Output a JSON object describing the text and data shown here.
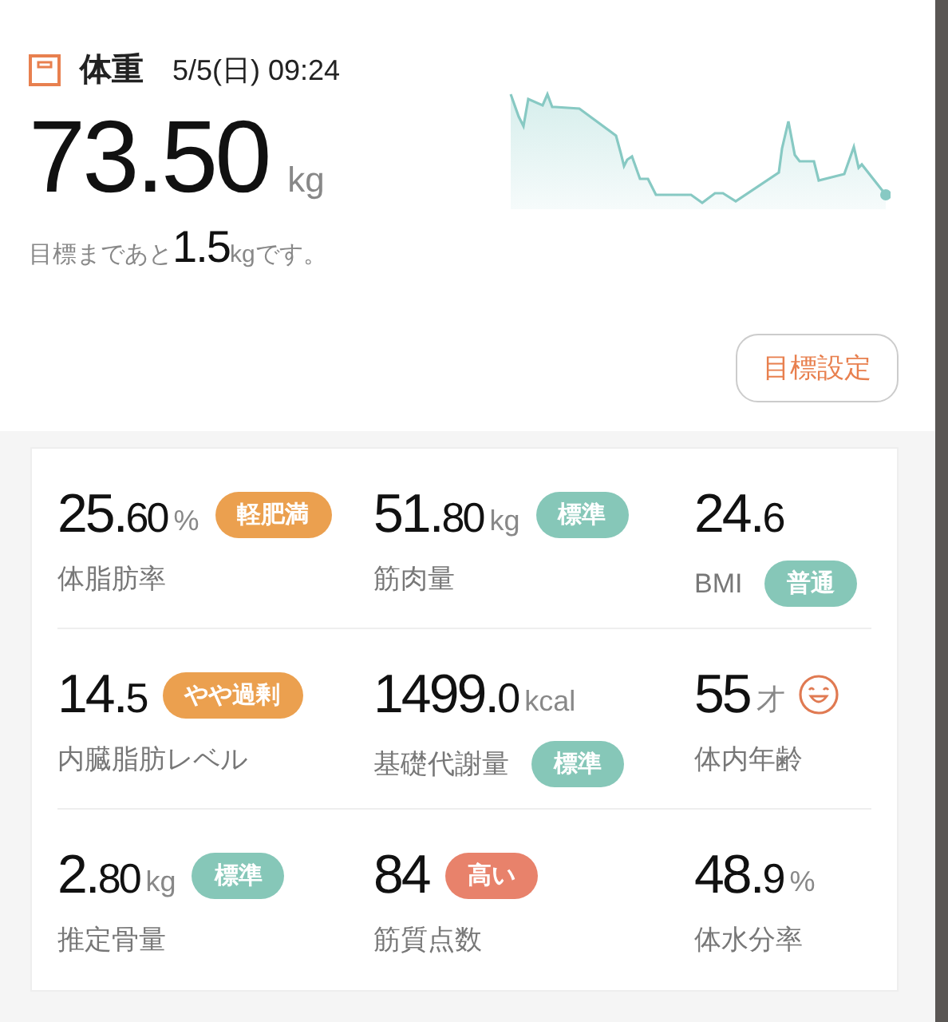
{
  "header": {
    "title": "体重",
    "datetime": "5/5(日) 09:24"
  },
  "weight": {
    "value": "73.50",
    "unit": "kg"
  },
  "goal": {
    "prefix": "目標まであと",
    "amount": "1.5",
    "unit": "kg",
    "suffix": "です。"
  },
  "goal_button": "目標設定",
  "metrics": [
    {
      "kind": "standard",
      "value_main": "25.",
      "value_decimal": "60",
      "unit": "%",
      "label": "体脂肪率",
      "badge": {
        "text": "軽肥満",
        "color": "#eba04f",
        "kind": "inline"
      }
    },
    {
      "kind": "standard",
      "value_main": "51.",
      "value_decimal": "80",
      "unit": "kg",
      "label": "筋肉量",
      "badge": {
        "text": "標準",
        "color": "#86c7b8",
        "kind": "inline"
      }
    },
    {
      "kind": "standard",
      "value_main": "24.",
      "value_decimal": "6",
      "label": "BMI",
      "badge": {
        "text": "普通",
        "color": "#86c7b8",
        "kind": "stacked"
      }
    },
    {
      "kind": "standard",
      "value_main": "14.",
      "value_decimal": "5",
      "label": "内臓脂肪レベル",
      "badge": {
        "text": "やや過剰",
        "color": "#eba04f",
        "kind": "inline"
      }
    },
    {
      "kind": "standard",
      "value_main": "1499.",
      "value_decimal": "0",
      "unit": "kcal",
      "label": "基礎代謝量",
      "badge": {
        "text": "標準",
        "color": "#86c7b8",
        "kind": "stacked"
      }
    },
    {
      "kind": "face",
      "value_main": "55",
      "unit": "才",
      "label": "体内年齢"
    },
    {
      "kind": "standard",
      "value_main": "2.",
      "value_decimal": "80",
      "unit": "kg",
      "label": "推定骨量",
      "badge": {
        "text": "標準",
        "color": "#86c7b8",
        "kind": "inline"
      }
    },
    {
      "kind": "standard",
      "value_main": "84",
      "label": "筋質点数",
      "badge": {
        "text": "高い",
        "color": "#e8826b",
        "kind": "inline"
      }
    },
    {
      "kind": "standard",
      "value_main": "48.",
      "value_decimal": "9",
      "unit": "%",
      "label": "体水分率"
    }
  ]
}
